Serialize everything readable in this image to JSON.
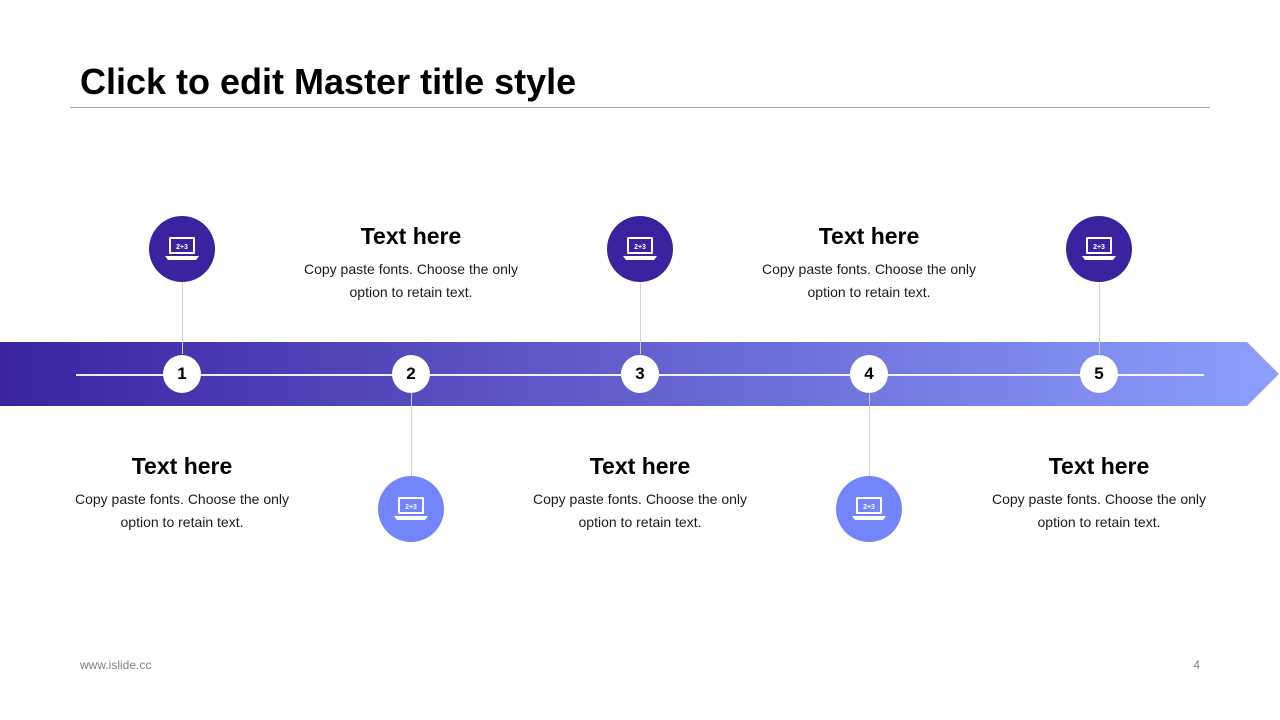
{
  "slide": {
    "title": "Click to edit Master title style",
    "footer_left": "www.islide.cc",
    "page_number": "4"
  },
  "colors": {
    "gradient_start": "#3b23a0",
    "gradient_end": "#8c9ffc",
    "icon_dark": "#3b23a0",
    "icon_light": "#7285fb"
  },
  "steps": [
    {
      "number": "1",
      "heading": "Text here",
      "body": "Copy paste fonts. Choose the only option to retain text.",
      "icon": "laptop-math-icon"
    },
    {
      "number": "2",
      "heading": "Text here",
      "body": "Copy paste fonts. Choose the only option to retain text.",
      "icon": "laptop-math-icon"
    },
    {
      "number": "3",
      "heading": "Text here",
      "body": "Copy paste fonts. Choose the only option to retain text.",
      "icon": "laptop-math-icon"
    },
    {
      "number": "4",
      "heading": "Text here",
      "body": "Copy paste fonts. Choose the only option to retain text.",
      "icon": "laptop-math-icon"
    },
    {
      "number": "5",
      "heading": "Text here",
      "body": "Copy paste fonts. Choose the only option to retain text.",
      "icon": "laptop-math-icon"
    }
  ]
}
